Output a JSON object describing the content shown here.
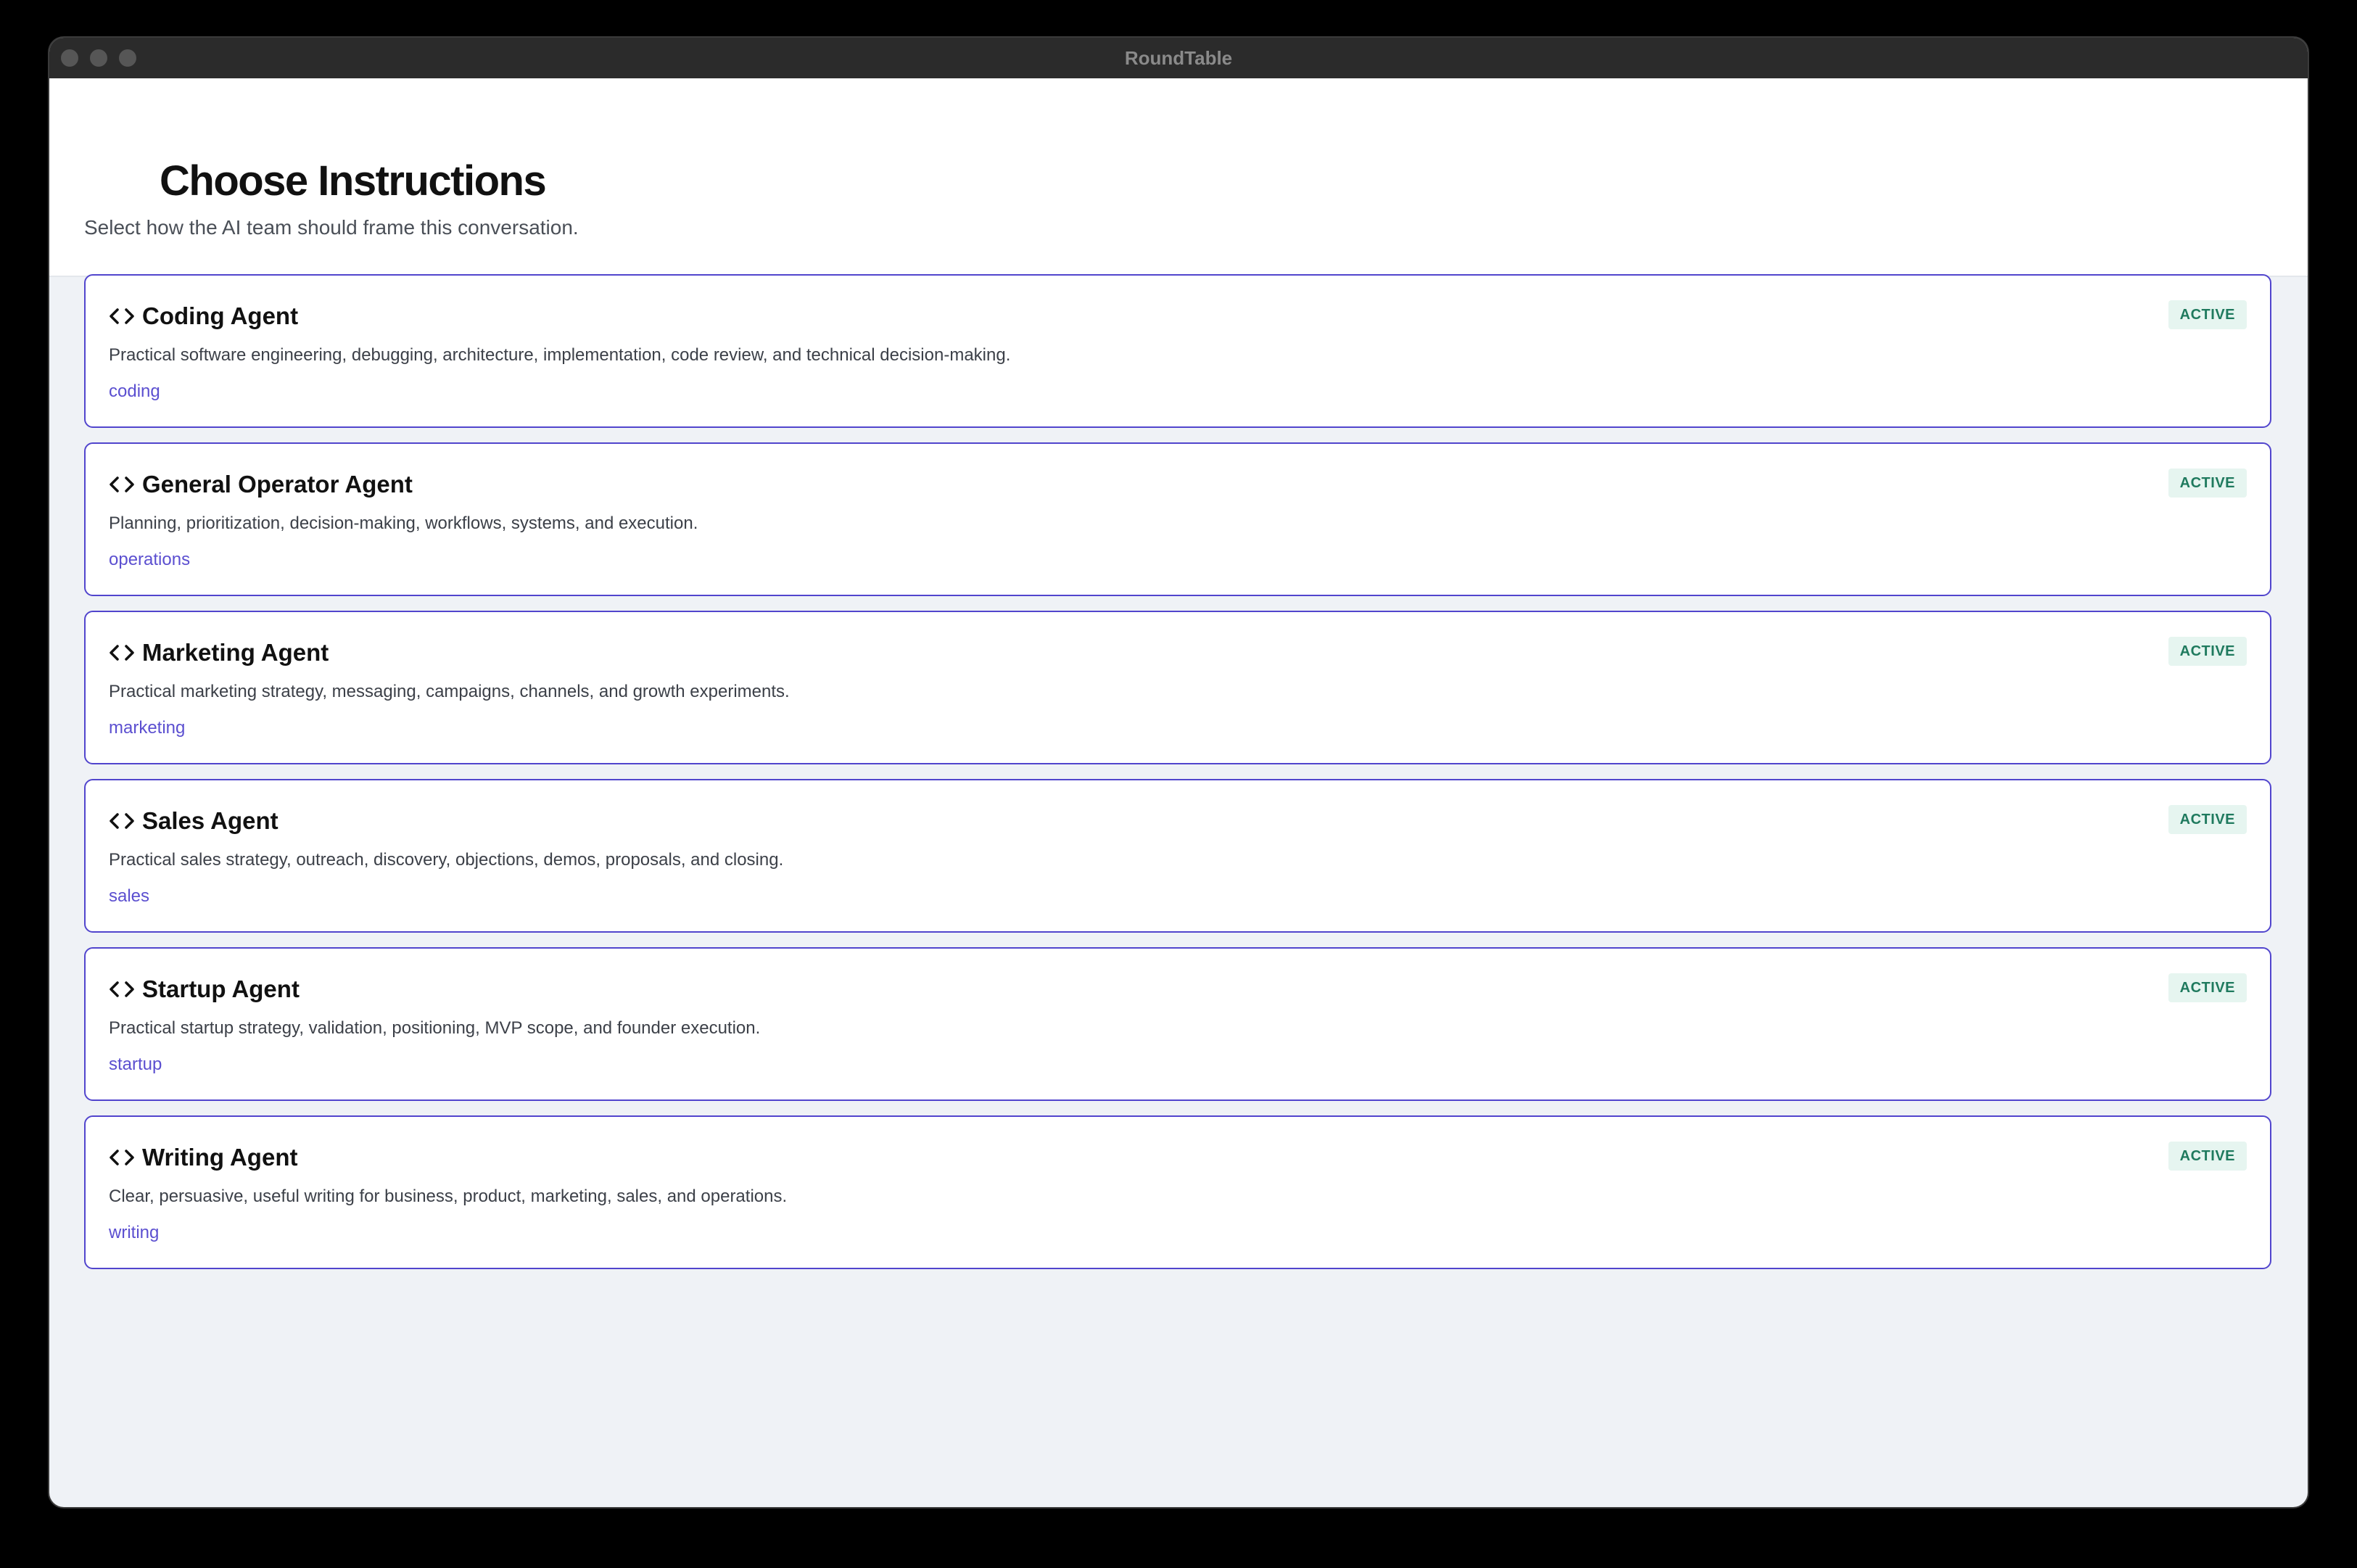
{
  "window": {
    "title": "RoundTable"
  },
  "header": {
    "title": "Choose Instructions",
    "subtitle": "Select how the AI team should frame this conversation."
  },
  "colors": {
    "card_border": "#5145cd",
    "tag_text": "#5b4fd0",
    "badge_bg": "#e6f5f0",
    "badge_text": "#1f7a5e",
    "content_bg": "#eff2f6"
  },
  "agents": [
    {
      "icon": "code-icon",
      "name": "Coding Agent",
      "description": "Practical software engineering, debugging, architecture, implementation, code review, and technical decision-making.",
      "tag": "coding",
      "status": "ACTIVE"
    },
    {
      "icon": "code-icon",
      "name": "General Operator Agent",
      "description": "Planning, prioritization, decision-making, workflows, systems, and execution.",
      "tag": "operations",
      "status": "ACTIVE"
    },
    {
      "icon": "code-icon",
      "name": "Marketing Agent",
      "description": "Practical marketing strategy, messaging, campaigns, channels, and growth experiments.",
      "tag": "marketing",
      "status": "ACTIVE"
    },
    {
      "icon": "code-icon",
      "name": "Sales Agent",
      "description": "Practical sales strategy, outreach, discovery, objections, demos, proposals, and closing.",
      "tag": "sales",
      "status": "ACTIVE"
    },
    {
      "icon": "code-icon",
      "name": "Startup Agent",
      "description": "Practical startup strategy, validation, positioning, MVP scope, and founder execution.",
      "tag": "startup",
      "status": "ACTIVE"
    },
    {
      "icon": "code-icon",
      "name": "Writing Agent",
      "description": "Clear, persuasive, useful writing for business, product, marketing, sales, and operations.",
      "tag": "writing",
      "status": "ACTIVE"
    }
  ]
}
